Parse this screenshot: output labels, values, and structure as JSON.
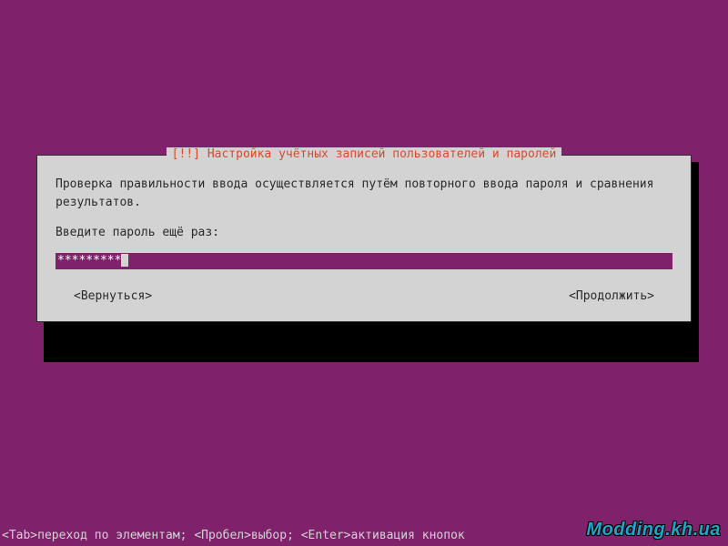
{
  "dialog": {
    "title_prefix": "[!!] ",
    "title": "Настройка учётных записей пользователей и паролей",
    "description": "Проверка правильности ввода осуществляется путём повторного ввода пароля и сравнения результатов.",
    "prompt": "Введите пароль ещё раз:",
    "password_masked": "*********",
    "back_label": "<Вернуться>",
    "continue_label": "<Продолжить>"
  },
  "status_bar": "<Tab>переход по элементам; <Пробел>выбор; <Enter>активация кнопок",
  "watermark": "Modding.kh.ua"
}
